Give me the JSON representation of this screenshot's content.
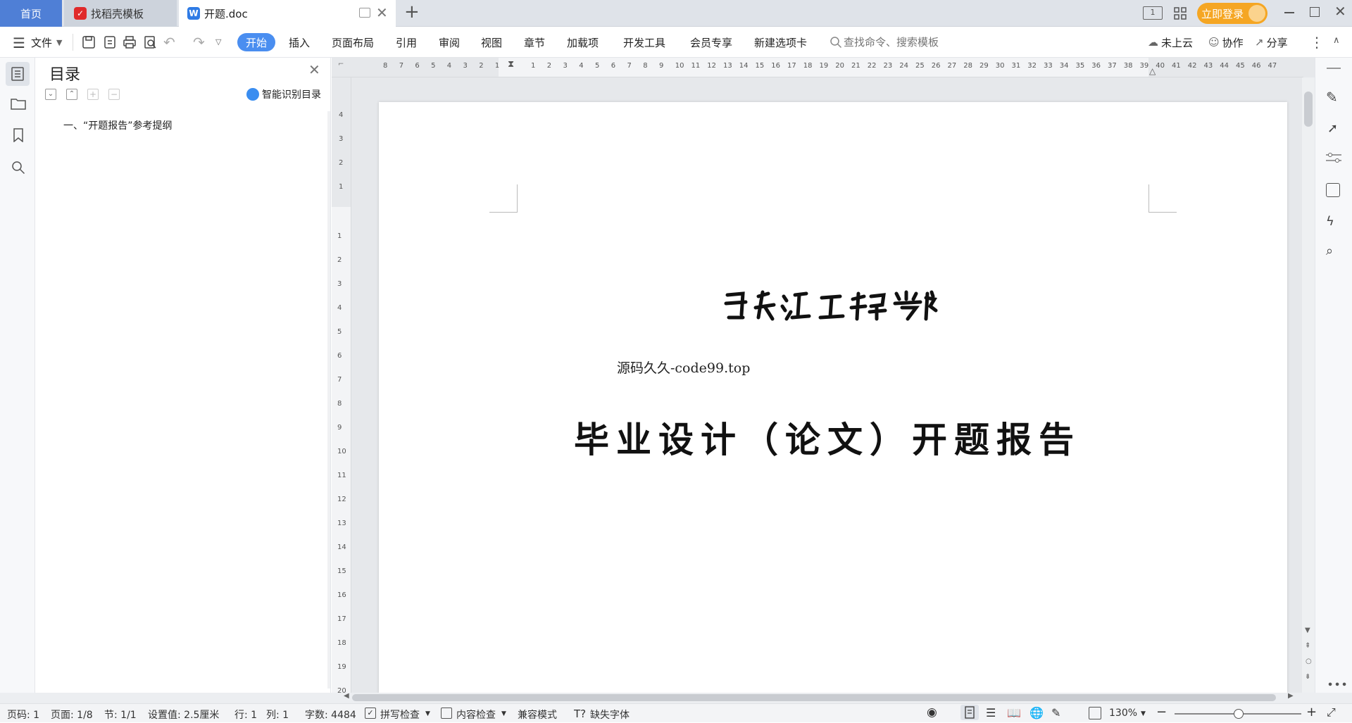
{
  "tabs": {
    "home": "首页",
    "docer": "找稻壳模板",
    "doc": "开题.doc",
    "add": "+"
  },
  "titlebar": {
    "login": "立即登录"
  },
  "toolbar": {
    "file": "文件",
    "ribbon": [
      "开始",
      "插入",
      "页面布局",
      "引用",
      "审阅",
      "视图",
      "章节",
      "加载项",
      "开发工具",
      "会员专享",
      "新建选项卡"
    ],
    "search_placeholder": "查找命令、搜索模板",
    "cloud": "未上云",
    "collab": "协作",
    "share": "分享"
  },
  "nav": {
    "title": "目录",
    "smart": "智能识别目录",
    "items": [
      "一、“开题报告”参考提纲"
    ]
  },
  "document": {
    "watermark": "源码久久-code99.top",
    "main_title": "毕业设计（论文）开题报告"
  },
  "ruler": {
    "h_left": [
      "8",
      "7",
      "6",
      "5",
      "4",
      "3",
      "2",
      "1"
    ],
    "h_right": [
      "1",
      "2",
      "3",
      "4",
      "5",
      "6",
      "7",
      "8",
      "9",
      "10",
      "11",
      "12",
      "13",
      "14",
      "15",
      "16",
      "17",
      "18",
      "19",
      "20",
      "21",
      "22",
      "23",
      "24",
      "25",
      "26",
      "27",
      "28",
      "29",
      "30",
      "31",
      "32",
      "33",
      "34",
      "35",
      "36",
      "37",
      "38",
      "39",
      "40",
      "41",
      "42",
      "43",
      "44",
      "45",
      "46",
      "47"
    ],
    "v_top": [
      "4",
      "3",
      "2",
      "1"
    ],
    "v_bottom": [
      "1",
      "2",
      "3",
      "4",
      "5",
      "6",
      "7",
      "8",
      "9",
      "10",
      "11",
      "12",
      "13",
      "14",
      "15",
      "16",
      "17",
      "18",
      "19",
      "20"
    ]
  },
  "status": {
    "page": "页码: 1",
    "pages": "页面: 1/8",
    "section": "节: 1/1",
    "setting": "设置值: 2.5厘米",
    "row": "行: 1",
    "col": "列: 1",
    "words": "字数: 4484",
    "spell": "拼写检查",
    "content": "内容检查",
    "compat": "兼容模式",
    "missing_font": "缺失字体",
    "zoom": "130%"
  }
}
